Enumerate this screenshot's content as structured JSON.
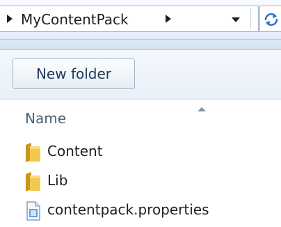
{
  "address_bar": {
    "breadcrumb": "MyContentPack",
    "dropdown_icon": "chevron-down-icon",
    "refresh_icon": "refresh-icon"
  },
  "toolbar": {
    "new_folder_label": "New folder"
  },
  "file_list": {
    "column_name": "Name",
    "sort_direction": "ascending",
    "items": [
      {
        "name": "Content",
        "type": "folder",
        "icon": "folder-icon"
      },
      {
        "name": "Lib",
        "type": "folder",
        "icon": "folder-icon"
      },
      {
        "name": "contentpack.properties",
        "type": "file",
        "icon": "document-icon"
      }
    ]
  },
  "colors": {
    "folder": "#e8b838",
    "chrome": "#dfe9f5",
    "accent_text": "#1e395b"
  }
}
